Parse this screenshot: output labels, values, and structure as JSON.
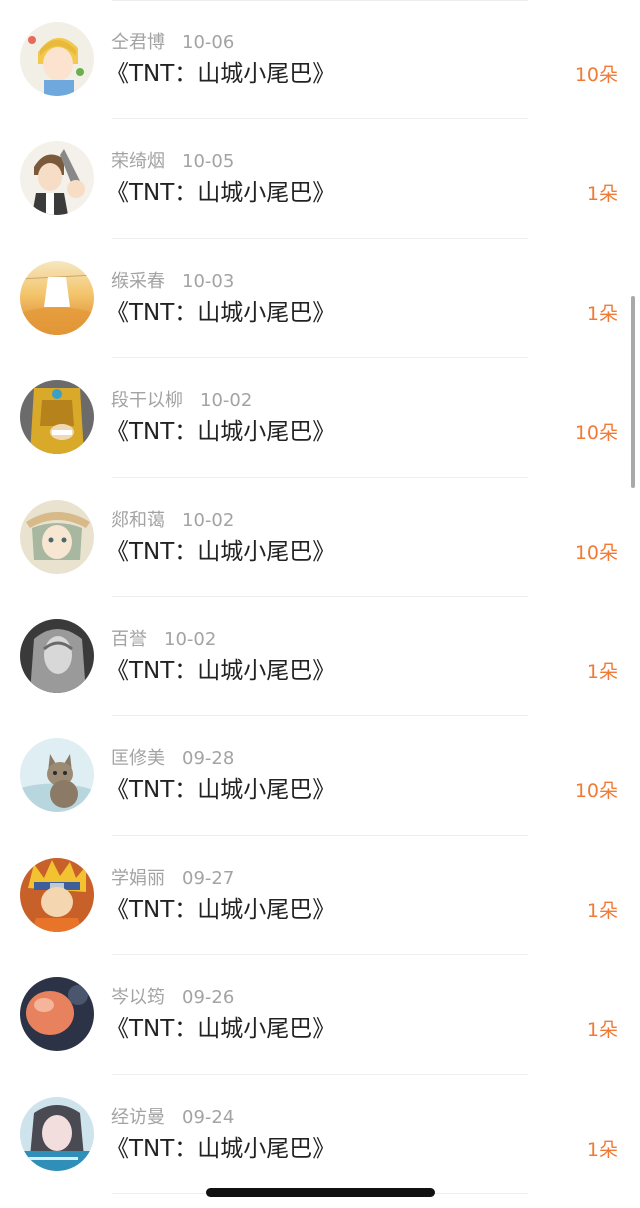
{
  "gift_color": "#f07a36",
  "title_color": "#222222",
  "meta_color": "#a3a3a3",
  "records": [
    {
      "name": "仝君博",
      "date": "10-06",
      "title": "《TNT：山城小尾巴》",
      "gift": "10朵",
      "avatar": "anime-boy-avatar"
    },
    {
      "name": "荣绮烟",
      "date": "10-05",
      "title": "《TNT：山城小尾巴》",
      "gift": "1朵",
      "avatar": "anime-character-avatar"
    },
    {
      "name": "缑采春",
      "date": "10-03",
      "title": "《TNT：山城小尾巴》",
      "gift": "1朵",
      "avatar": "field-photo-avatar"
    },
    {
      "name": "段干以柳",
      "date": "10-02",
      "title": "《TNT：山城小尾巴》",
      "gift": "10朵",
      "avatar": "masked-character-avatar"
    },
    {
      "name": "郯和蔼",
      "date": "10-02",
      "title": "《TNT：山城小尾巴》",
      "gift": "10朵",
      "avatar": "anime-girl-avatar"
    },
    {
      "name": "百誉",
      "date": "10-02",
      "title": "《TNT：山城小尾巴》",
      "gift": "1朵",
      "avatar": "portrait-photo-avatar"
    },
    {
      "name": "匡修美",
      "date": "09-28",
      "title": "《TNT：山城小尾巴》",
      "gift": "10朵",
      "avatar": "kitten-photo-avatar"
    },
    {
      "name": "学娟丽",
      "date": "09-27",
      "title": "《TNT：山城小尾巴》",
      "gift": "1朵",
      "avatar": "ninja-character-avatar"
    },
    {
      "name": "岑以筠",
      "date": "09-26",
      "title": "《TNT：山城小尾巴》",
      "gift": "1朵",
      "avatar": "orange-object-avatar"
    },
    {
      "name": "经访曼",
      "date": "09-24",
      "title": "《TNT：山城小尾巴》",
      "gift": "1朵",
      "avatar": "girl-photo-avatar"
    }
  ]
}
